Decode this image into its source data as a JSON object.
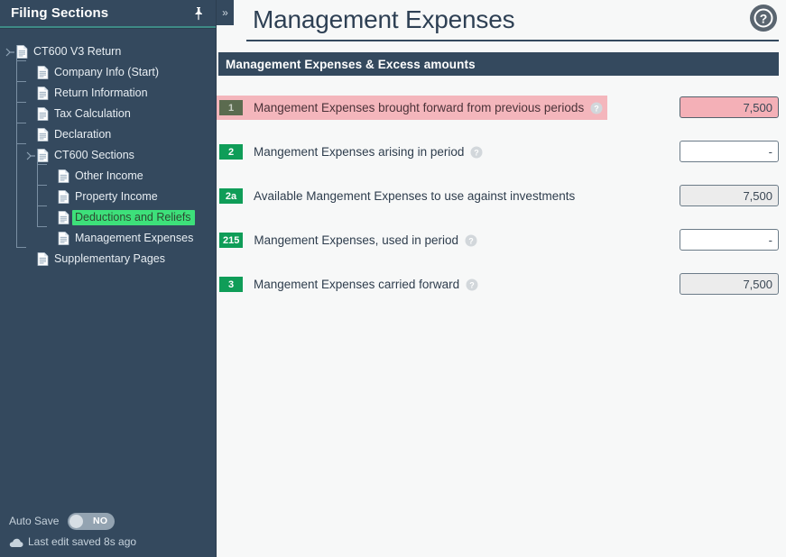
{
  "sidebar": {
    "title": "Filing Sections",
    "pin_icon": "pin-icon",
    "tree": [
      {
        "label": "CT600 V3 Return",
        "depth": 0,
        "selected": false,
        "icon": "document-icon",
        "expander": true
      },
      {
        "label": "Company Info (Start)",
        "depth": 1,
        "selected": false,
        "icon": "document-icon",
        "expander": false
      },
      {
        "label": "Return Information",
        "depth": 1,
        "selected": false,
        "icon": "document-icon",
        "expander": false
      },
      {
        "label": "Tax Calculation",
        "depth": 1,
        "selected": false,
        "icon": "document-icon",
        "expander": false
      },
      {
        "label": "Declaration",
        "depth": 1,
        "selected": false,
        "icon": "document-icon",
        "expander": false
      },
      {
        "label": "CT600 Sections",
        "depth": 1,
        "selected": false,
        "icon": "document-icon",
        "expander": true
      },
      {
        "label": "Other Income",
        "depth": 2,
        "selected": false,
        "icon": "document-icon",
        "expander": false
      },
      {
        "label": "Property Income",
        "depth": 2,
        "selected": false,
        "icon": "document-icon",
        "expander": false
      },
      {
        "label": "Deductions and Reliefs",
        "depth": 2,
        "selected": true,
        "icon": "document-icon",
        "expander": false
      },
      {
        "label": "Management Expenses",
        "depth": 2,
        "selected": false,
        "icon": "document-icon",
        "expander": false
      },
      {
        "label": "Supplementary Pages",
        "depth": 1,
        "selected": false,
        "icon": "document-icon",
        "expander": false
      }
    ],
    "footer": {
      "autosave_label": "Auto Save",
      "autosave_value": "NO",
      "cloud_icon": "cloud-icon",
      "saved_text": "Last edit saved 8s ago"
    }
  },
  "main": {
    "collapse_icon": "»",
    "page_title": "Management Expenses",
    "help_icon": "help-circle-icon",
    "section_header": "Management Expenses & Excess amounts",
    "rows": [
      {
        "badge": "1",
        "label": "Mangement Expenses brought forward from previous periods",
        "has_help": true,
        "value": "7,500",
        "state": "error",
        "readonly": false
      },
      {
        "badge": "2",
        "label": "Mangement Expenses arising in period",
        "has_help": true,
        "value": "-",
        "state": "normal",
        "readonly": false
      },
      {
        "badge": "2a",
        "label": "Available Mangement Expenses to use against investments",
        "has_help": false,
        "value": "7,500",
        "state": "normal",
        "readonly": true
      },
      {
        "badge": "215",
        "label": "Mangement Expenses, used in period",
        "has_help": true,
        "value": "-",
        "state": "normal",
        "readonly": false
      },
      {
        "badge": "3",
        "label": "Mangement Expenses carried forward",
        "has_help": true,
        "value": "7,500",
        "state": "normal",
        "readonly": true
      }
    ]
  },
  "colors": {
    "sidebar_bg": "#34495e",
    "accent_teal": "#3e8a86",
    "badge_green": "#0f9d58",
    "selection_green": "#3de07a",
    "error_pink": "#f4b6bc",
    "main_bg": "#f7f8f8"
  }
}
